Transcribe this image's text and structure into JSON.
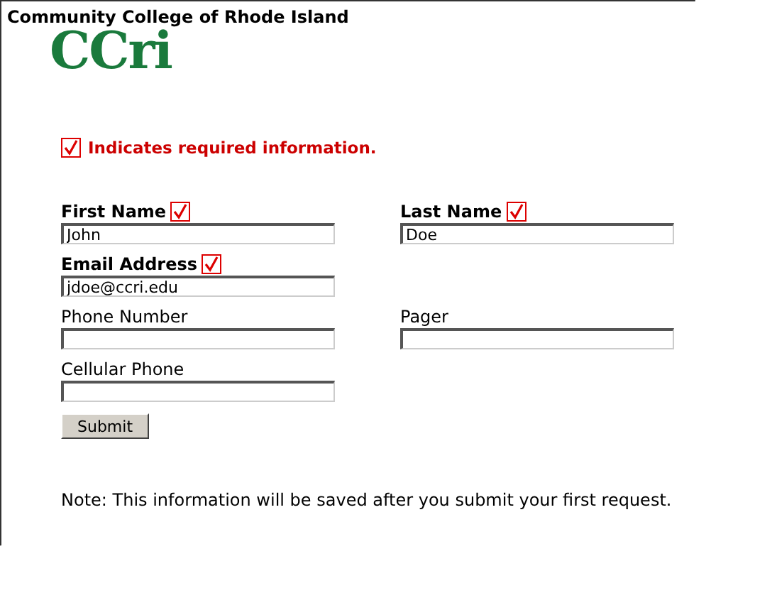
{
  "header": {
    "title": "Community College of Rhode Island",
    "logo": "CCri"
  },
  "required_note": "Indicates required information.",
  "fields": [
    {
      "label": "First Name",
      "required": true,
      "value": "John"
    },
    {
      "label": "Last Name",
      "required": true,
      "value": "Doe"
    },
    {
      "label": "Email Address",
      "required": true,
      "value": "jdoe@ccri.edu"
    },
    {
      "label": "Phone Number",
      "required": false
    },
    {
      "label": "Pager",
      "required": false
    },
    {
      "label": "Cellular Phone",
      "required": false
    }
  ],
  "submit": "Submit",
  "note": "Note: This information will be saved after you submit your first request."
}
